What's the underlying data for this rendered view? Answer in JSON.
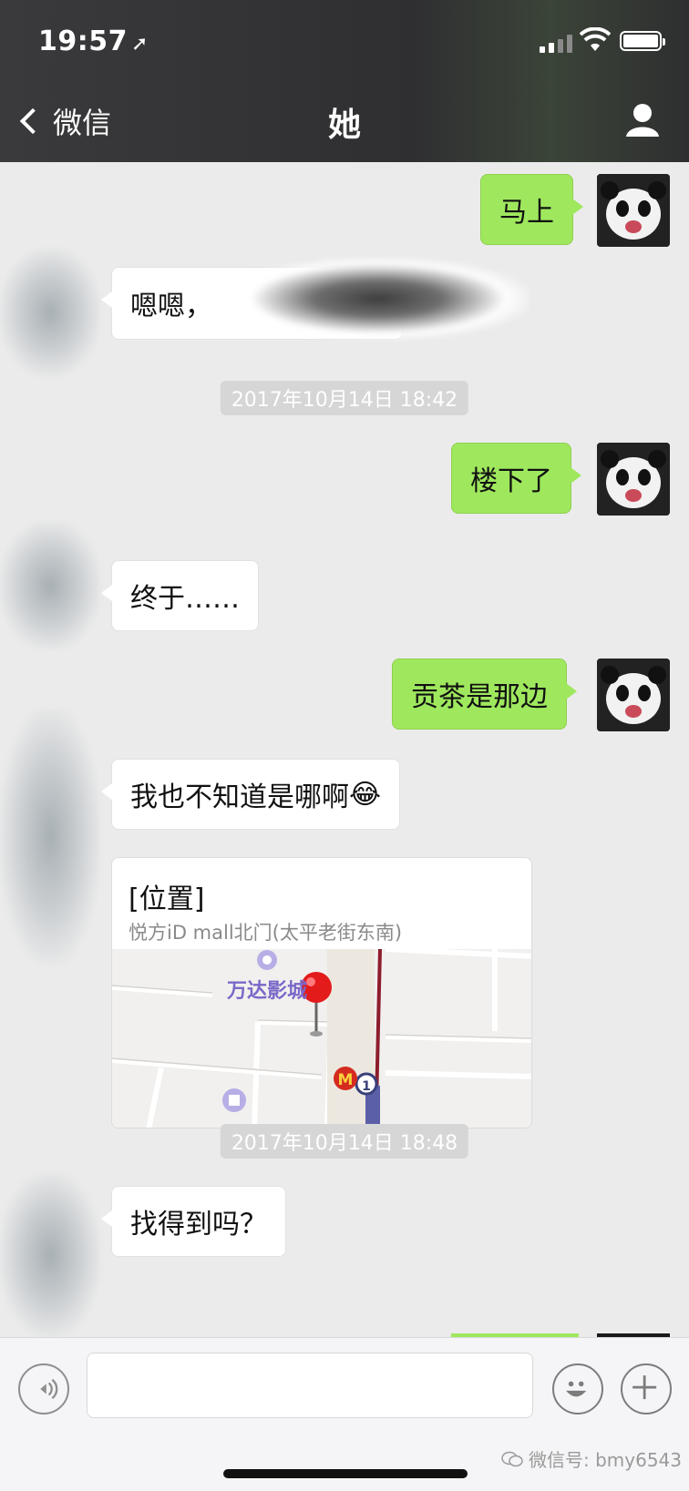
{
  "status_bar": {
    "time": "19:57",
    "location_arrow": "➚"
  },
  "nav": {
    "back_label": "微信",
    "title": "她"
  },
  "messages": [
    {
      "side": "me",
      "text": "马上"
    },
    {
      "side": "other",
      "text": "嗯嗯，"
    },
    {
      "type": "timestamp",
      "text": "2017年10月14日 18:42"
    },
    {
      "side": "me",
      "text": "楼下了"
    },
    {
      "side": "other",
      "text": "终于……"
    },
    {
      "side": "me",
      "text": "贡茶是那边"
    },
    {
      "side": "other",
      "text": "我也不知道是哪啊",
      "emoji": "😂"
    },
    {
      "side": "other",
      "type": "location",
      "title": "[位置]",
      "subtitle": "悦方iD mall北门(太平老街东南)",
      "map_label": "万达影城",
      "map_badge": "1",
      "map_m": "M"
    },
    {
      "type": "timestamp",
      "text": "2017年10月14日 18:48"
    },
    {
      "side": "other",
      "text": "找得到吗？"
    }
  ],
  "input_bar": {
    "placeholder": ""
  },
  "watermark": {
    "text": "微信号: bmy6543"
  },
  "colors": {
    "my_bubble": "#9fe85e",
    "other_bubble": "#ffffff",
    "chat_bg": "#ebebeb",
    "header_bg": "#3a3a3c"
  },
  "icons": {
    "back": "chevron-left-icon",
    "profile": "person-icon",
    "voice": "voice-icon",
    "emoji": "emoji-icon",
    "plus": "plus-icon"
  }
}
